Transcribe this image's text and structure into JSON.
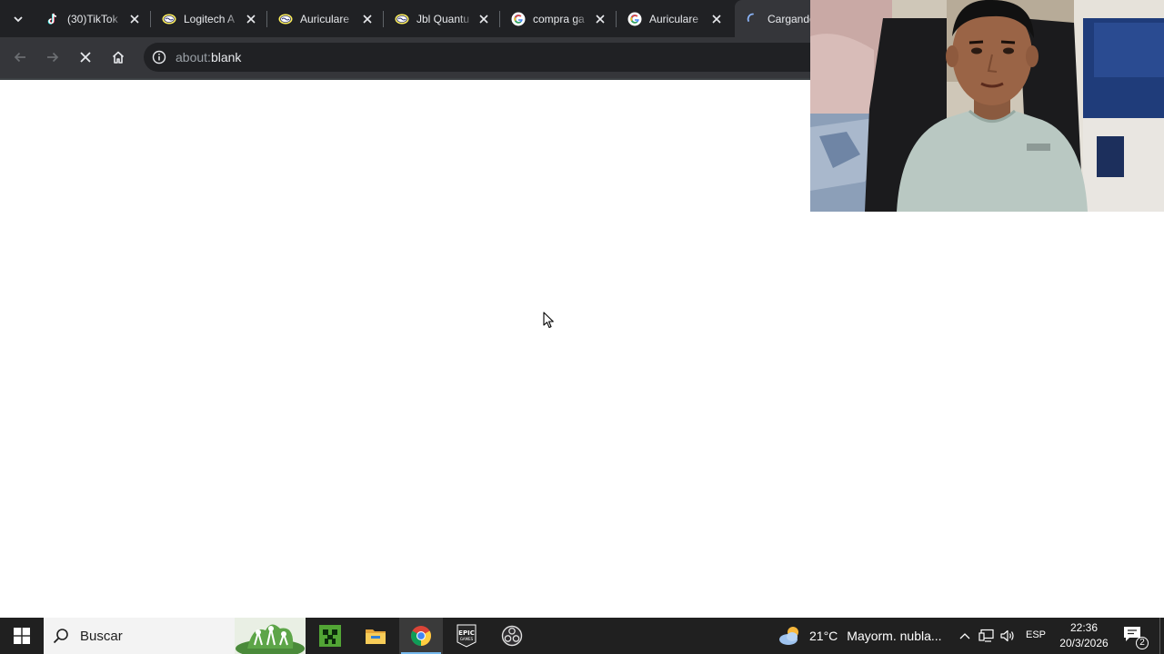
{
  "browser": {
    "tabs": [
      {
        "title": "(30)TikTok",
        "favicon": "tiktok-icon"
      },
      {
        "title": "Logitech A",
        "favicon": "mercadolibre-icon"
      },
      {
        "title": "Auriculare",
        "favicon": "mercadolibre-icon"
      },
      {
        "title": "Jbl Quantu",
        "favicon": "mercadolibre-icon"
      },
      {
        "title": "compra ga",
        "favicon": "google-icon"
      },
      {
        "title": "Auriculare",
        "favicon": "google-icon"
      },
      {
        "title": "Cargando",
        "favicon": "loading-spinner-icon",
        "active": true
      }
    ],
    "address_bar": {
      "scheme": "about:",
      "host": "blank"
    },
    "colors": {
      "frame": "#202124",
      "toolbar": "#35363a",
      "accent": "#8ab4f8"
    }
  },
  "taskbar": {
    "search_placeholder": "Buscar",
    "apps": [
      "minecraft-icon",
      "file-explorer-icon",
      "chrome-icon",
      "epic-games-icon",
      "obs-icon"
    ],
    "weather": {
      "temp": "21°C",
      "desc": "Mayorm. nubla..."
    },
    "language": "ESP",
    "clock": {
      "time": "22:36",
      "date": "20/3/2026"
    },
    "notifications_count": "2",
    "epic_label": "EPIC",
    "epic_label_2": "GAMES"
  }
}
